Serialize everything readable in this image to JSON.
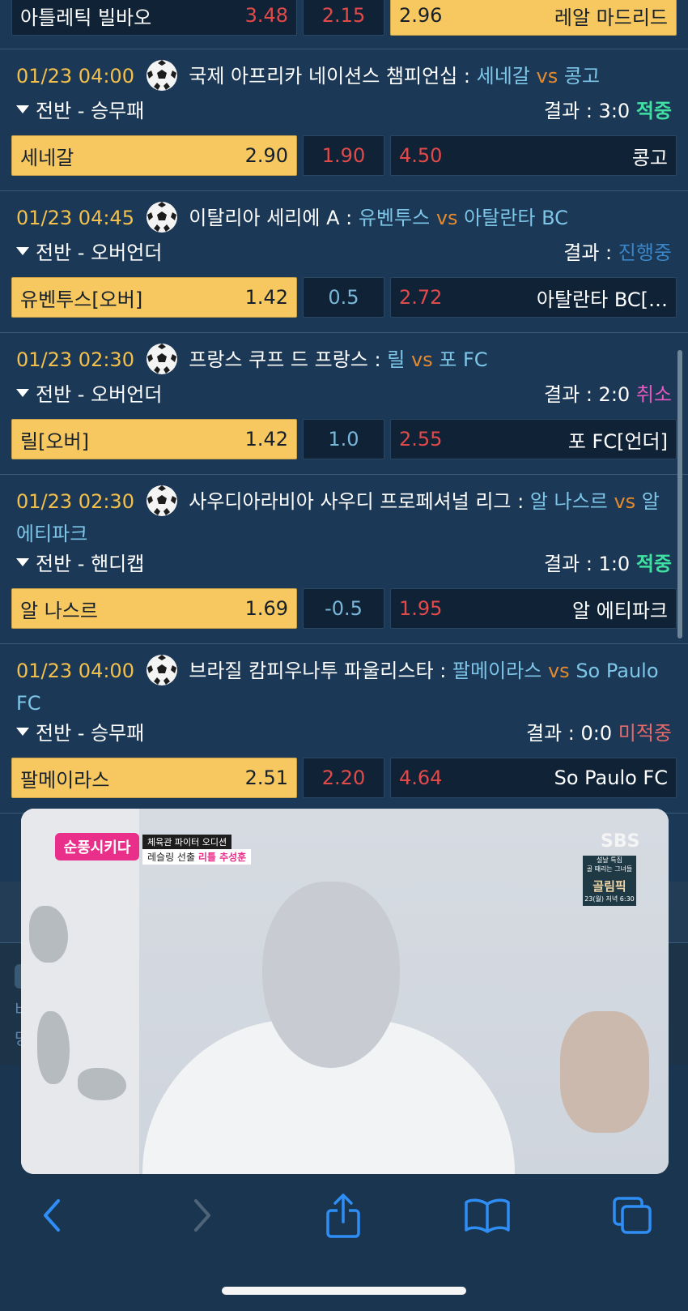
{
  "top_row": {
    "home": "아틀레틱 빌바오",
    "home_odds": "3.48",
    "draw": "2.15",
    "away_odds": "2.96",
    "away": "레알 마드리드"
  },
  "matches": [
    {
      "time": "01/23 04:00",
      "league": "국제 아프리카 네이션스 챔피언십",
      "home": "세네갈",
      "vs": "vs",
      "away": "콩고",
      "market": "전반 - 승무패",
      "result_label": "결과 : 3:0",
      "status": "적중",
      "odds": {
        "home": "세네갈",
        "home_odds": "2.90",
        "mid": "1.90",
        "away_odds": "4.50",
        "away": "콩고"
      }
    },
    {
      "time": "01/23 04:45",
      "league": "이탈리아 세리에 A",
      "home": "유벤투스",
      "vs": "vs",
      "away": "아탈란타 BC",
      "market": "전반 - 오버언더",
      "result_label": "결과 :",
      "status": "진행중",
      "odds": {
        "home": "유벤투스[오버]",
        "home_odds": "1.42",
        "mid": "0.5",
        "away_odds": "2.72",
        "away": "아탈란타 BC[…"
      }
    },
    {
      "time": "01/23 02:30",
      "league": "프랑스 쿠프 드 프랑스",
      "home": "릴",
      "vs": "vs",
      "away": "포 FC",
      "market": "전반 - 오버언더",
      "result_label": "결과 : 2:0",
      "status": "취소",
      "odds": {
        "home": "릴[오버]",
        "home_odds": "1.42",
        "mid": "1.0",
        "away_odds": "2.55",
        "away": "포 FC[언더]"
      }
    },
    {
      "time": "01/23 02:30",
      "league": "사우디아라비아 사우디 프로페셔널 리그",
      "home": "알 나스르",
      "vs": "vs",
      "away": "알 에티파크",
      "market": "전반 - 핸디캡",
      "result_label": "결과 : 1:0",
      "status": "적중",
      "odds": {
        "home": "알 나스르",
        "home_odds": "1.69",
        "mid": "-0.5",
        "away_odds": "1.95",
        "away": "알 에티파크"
      }
    },
    {
      "time": "01/23 04:00",
      "league": "브라질 캄피우나투 파울리스타",
      "home": "팔메이라스",
      "vs": "vs",
      "away": "So Paulo FC",
      "market": "전반 - 승무패",
      "result_label": "결과 : 0:0",
      "status": "미적중",
      "odds": {
        "home": "팔메이라스",
        "home_odds": "2.51",
        "mid": "2.20",
        "away_odds": "4.64",
        "away": "So Paulo FC"
      }
    }
  ],
  "lower_partial": {
    "line1": "비",
    "line2": "당"
  },
  "video": {
    "show_logo": "순풍시키다",
    "caption_top": "체육관 파이터 오디션",
    "caption_bottom": "레슬링 선출",
    "caption_highlight": "리틀 추성훈",
    "broadcaster": "SBS",
    "promo_top": "설날 특집",
    "promo_sub": "골 때리는 그녀들",
    "promo_title": "골림픽",
    "promo_time": "23(월) 저녁 6:30"
  },
  "toolbar": {
    "icons": [
      "back-icon",
      "forward-icon",
      "share-icon",
      "bookmarks-icon",
      "tabs-icon"
    ]
  },
  "colors": {
    "accent_yellow": "#f6c85f",
    "odds_red": "#e24a4a",
    "team_blue": "#7ec6e8",
    "vs_orange": "#e38a2e",
    "hit_green": "#3fe0a2",
    "progress_blue": "#3a86c8",
    "cancel_pink": "#e858c0",
    "miss_red": "#e86a6a",
    "time_yellow": "#f3c04c"
  }
}
